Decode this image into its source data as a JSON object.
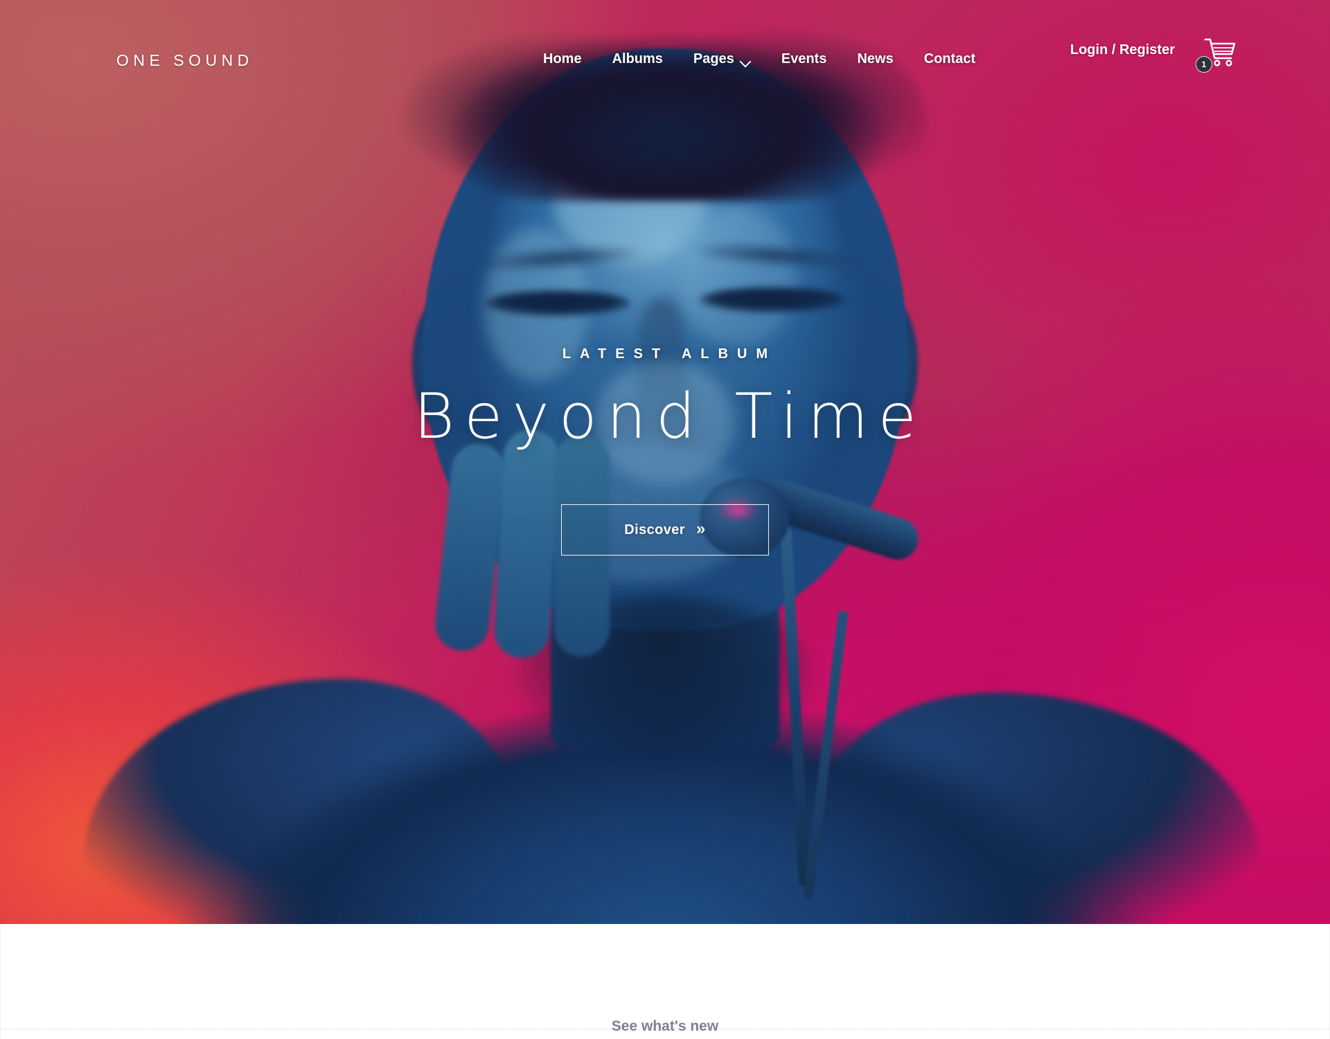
{
  "site": {
    "logo": "ONE SOUND"
  },
  "nav": {
    "items": [
      {
        "label": "Home",
        "has_dropdown": false
      },
      {
        "label": "Albums",
        "has_dropdown": false
      },
      {
        "label": "Pages",
        "has_dropdown": true
      },
      {
        "label": "Events",
        "has_dropdown": false
      },
      {
        "label": "News",
        "has_dropdown": false
      },
      {
        "label": "Contact",
        "has_dropdown": false
      }
    ]
  },
  "account": {
    "login_label": "Login / Register"
  },
  "cart": {
    "icon": "shopping-cart-icon",
    "count": "1"
  },
  "hero": {
    "eyebrow": "LATEST ALBUM",
    "title": "Beyond Time",
    "cta_label": "Discover",
    "cta_icon": "»",
    "image_alt": "singer with blue body paint holding a microphone against a red and magenta backdrop"
  },
  "below_fold": {
    "see_whats_new": "See what's new"
  },
  "colors": {
    "hero_red": "#b95059",
    "hero_magenta": "#c80f6a",
    "hero_orange": "#f0583a",
    "figure_blue": "#2a629b",
    "text_white": "#ffffff",
    "muted_text": "#7c8196",
    "badge_dark": "#2f2f35"
  }
}
